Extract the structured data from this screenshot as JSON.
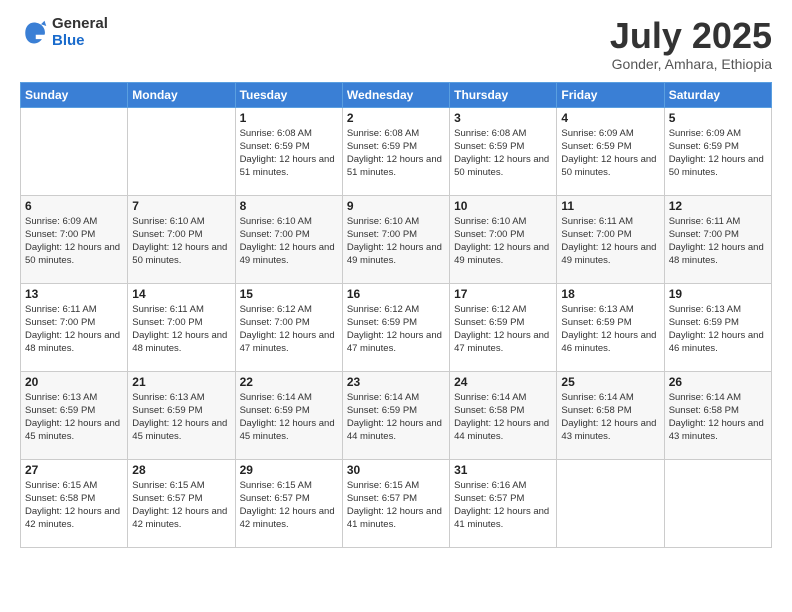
{
  "logo": {
    "general": "General",
    "blue": "Blue"
  },
  "header": {
    "month": "July 2025",
    "location": "Gonder, Amhara, Ethiopia"
  },
  "weekdays": [
    "Sunday",
    "Monday",
    "Tuesday",
    "Wednesday",
    "Thursday",
    "Friday",
    "Saturday"
  ],
  "weeks": [
    [
      {
        "day": "",
        "info": ""
      },
      {
        "day": "",
        "info": ""
      },
      {
        "day": "1",
        "info": "Sunrise: 6:08 AM\nSunset: 6:59 PM\nDaylight: 12 hours and 51 minutes."
      },
      {
        "day": "2",
        "info": "Sunrise: 6:08 AM\nSunset: 6:59 PM\nDaylight: 12 hours and 51 minutes."
      },
      {
        "day": "3",
        "info": "Sunrise: 6:08 AM\nSunset: 6:59 PM\nDaylight: 12 hours and 50 minutes."
      },
      {
        "day": "4",
        "info": "Sunrise: 6:09 AM\nSunset: 6:59 PM\nDaylight: 12 hours and 50 minutes."
      },
      {
        "day": "5",
        "info": "Sunrise: 6:09 AM\nSunset: 6:59 PM\nDaylight: 12 hours and 50 minutes."
      }
    ],
    [
      {
        "day": "6",
        "info": "Sunrise: 6:09 AM\nSunset: 7:00 PM\nDaylight: 12 hours and 50 minutes."
      },
      {
        "day": "7",
        "info": "Sunrise: 6:10 AM\nSunset: 7:00 PM\nDaylight: 12 hours and 50 minutes."
      },
      {
        "day": "8",
        "info": "Sunrise: 6:10 AM\nSunset: 7:00 PM\nDaylight: 12 hours and 49 minutes."
      },
      {
        "day": "9",
        "info": "Sunrise: 6:10 AM\nSunset: 7:00 PM\nDaylight: 12 hours and 49 minutes."
      },
      {
        "day": "10",
        "info": "Sunrise: 6:10 AM\nSunset: 7:00 PM\nDaylight: 12 hours and 49 minutes."
      },
      {
        "day": "11",
        "info": "Sunrise: 6:11 AM\nSunset: 7:00 PM\nDaylight: 12 hours and 49 minutes."
      },
      {
        "day": "12",
        "info": "Sunrise: 6:11 AM\nSunset: 7:00 PM\nDaylight: 12 hours and 48 minutes."
      }
    ],
    [
      {
        "day": "13",
        "info": "Sunrise: 6:11 AM\nSunset: 7:00 PM\nDaylight: 12 hours and 48 minutes."
      },
      {
        "day": "14",
        "info": "Sunrise: 6:11 AM\nSunset: 7:00 PM\nDaylight: 12 hours and 48 minutes."
      },
      {
        "day": "15",
        "info": "Sunrise: 6:12 AM\nSunset: 7:00 PM\nDaylight: 12 hours and 47 minutes."
      },
      {
        "day": "16",
        "info": "Sunrise: 6:12 AM\nSunset: 6:59 PM\nDaylight: 12 hours and 47 minutes."
      },
      {
        "day": "17",
        "info": "Sunrise: 6:12 AM\nSunset: 6:59 PM\nDaylight: 12 hours and 47 minutes."
      },
      {
        "day": "18",
        "info": "Sunrise: 6:13 AM\nSunset: 6:59 PM\nDaylight: 12 hours and 46 minutes."
      },
      {
        "day": "19",
        "info": "Sunrise: 6:13 AM\nSunset: 6:59 PM\nDaylight: 12 hours and 46 minutes."
      }
    ],
    [
      {
        "day": "20",
        "info": "Sunrise: 6:13 AM\nSunset: 6:59 PM\nDaylight: 12 hours and 45 minutes."
      },
      {
        "day": "21",
        "info": "Sunrise: 6:13 AM\nSunset: 6:59 PM\nDaylight: 12 hours and 45 minutes."
      },
      {
        "day": "22",
        "info": "Sunrise: 6:14 AM\nSunset: 6:59 PM\nDaylight: 12 hours and 45 minutes."
      },
      {
        "day": "23",
        "info": "Sunrise: 6:14 AM\nSunset: 6:59 PM\nDaylight: 12 hours and 44 minutes."
      },
      {
        "day": "24",
        "info": "Sunrise: 6:14 AM\nSunset: 6:58 PM\nDaylight: 12 hours and 44 minutes."
      },
      {
        "day": "25",
        "info": "Sunrise: 6:14 AM\nSunset: 6:58 PM\nDaylight: 12 hours and 43 minutes."
      },
      {
        "day": "26",
        "info": "Sunrise: 6:14 AM\nSunset: 6:58 PM\nDaylight: 12 hours and 43 minutes."
      }
    ],
    [
      {
        "day": "27",
        "info": "Sunrise: 6:15 AM\nSunset: 6:58 PM\nDaylight: 12 hours and 42 minutes."
      },
      {
        "day": "28",
        "info": "Sunrise: 6:15 AM\nSunset: 6:57 PM\nDaylight: 12 hours and 42 minutes."
      },
      {
        "day": "29",
        "info": "Sunrise: 6:15 AM\nSunset: 6:57 PM\nDaylight: 12 hours and 42 minutes."
      },
      {
        "day": "30",
        "info": "Sunrise: 6:15 AM\nSunset: 6:57 PM\nDaylight: 12 hours and 41 minutes."
      },
      {
        "day": "31",
        "info": "Sunrise: 6:16 AM\nSunset: 6:57 PM\nDaylight: 12 hours and 41 minutes."
      },
      {
        "day": "",
        "info": ""
      },
      {
        "day": "",
        "info": ""
      }
    ]
  ]
}
